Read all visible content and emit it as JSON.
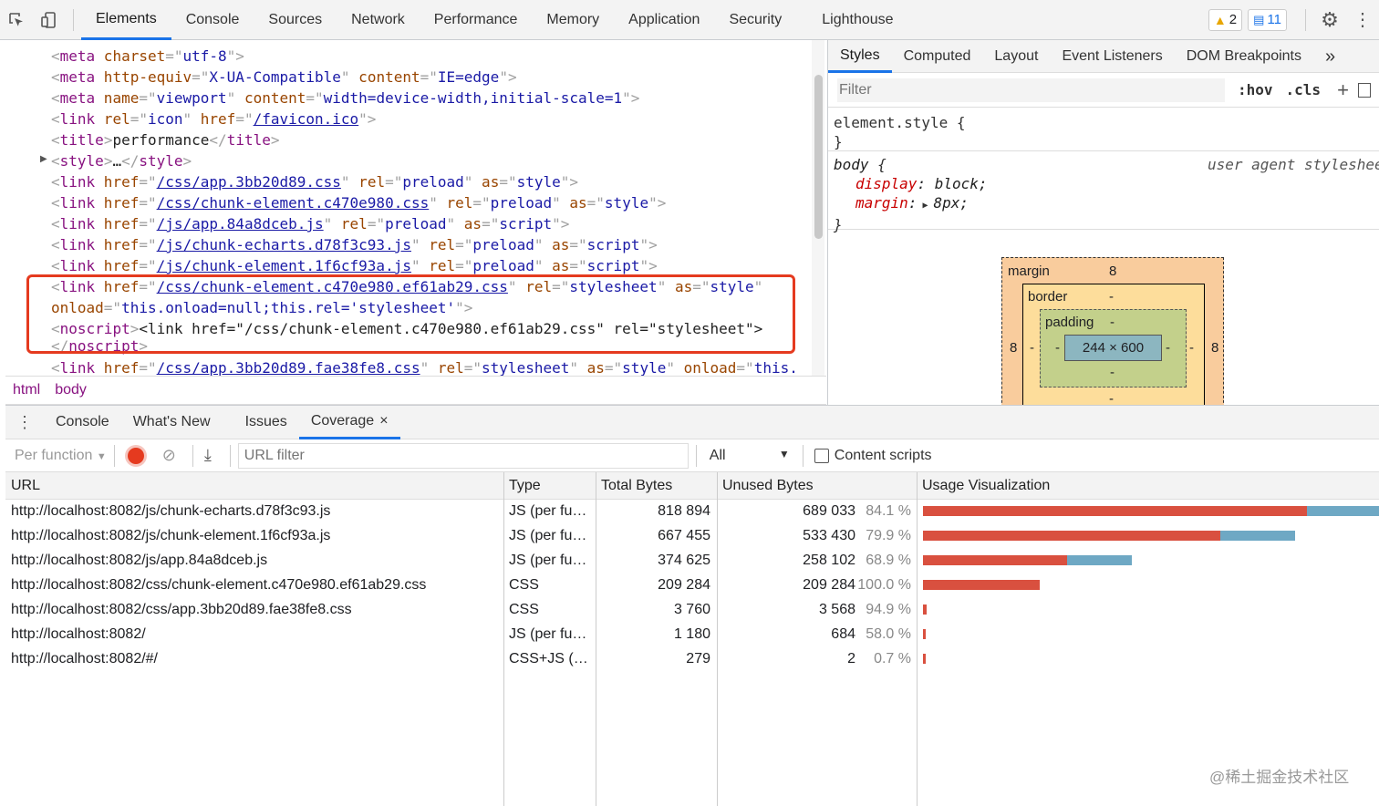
{
  "toolbar": {
    "tabs": [
      "Elements",
      "Console",
      "Sources",
      "Network",
      "Performance",
      "Memory",
      "Application",
      "Security",
      "Lighthouse"
    ],
    "active_tab": "Elements",
    "warnings": "2",
    "messages": "11"
  },
  "elements": {
    "lines": [
      {
        "parts": [
          [
            "punct",
            "<"
          ],
          [
            "tag",
            "meta"
          ],
          [
            "attr",
            " charset"
          ],
          [
            "punct",
            "=\""
          ],
          [
            "val",
            "utf-8"
          ],
          [
            "punct",
            "\">"
          ]
        ]
      },
      {
        "parts": [
          [
            "punct",
            "<"
          ],
          [
            "tag",
            "meta"
          ],
          [
            "attr",
            " http-equiv"
          ],
          [
            "punct",
            "=\""
          ],
          [
            "val",
            "X-UA-Compatible"
          ],
          [
            "punct",
            "\""
          ],
          [
            "attr",
            " content"
          ],
          [
            "punct",
            "=\""
          ],
          [
            "val",
            "IE=edge"
          ],
          [
            "punct",
            "\">"
          ]
        ]
      },
      {
        "parts": [
          [
            "punct",
            "<"
          ],
          [
            "tag",
            "meta"
          ],
          [
            "attr",
            " name"
          ],
          [
            "punct",
            "=\""
          ],
          [
            "val",
            "viewport"
          ],
          [
            "punct",
            "\""
          ],
          [
            "attr",
            " content"
          ],
          [
            "punct",
            "=\""
          ],
          [
            "val",
            "width=device-width,initial-scale=1"
          ],
          [
            "punct",
            "\">"
          ]
        ]
      },
      {
        "parts": [
          [
            "punct",
            "<"
          ],
          [
            "tag",
            "link"
          ],
          [
            "attr",
            " rel"
          ],
          [
            "punct",
            "=\""
          ],
          [
            "val",
            "icon"
          ],
          [
            "punct",
            "\""
          ],
          [
            "attr",
            " href"
          ],
          [
            "punct",
            "=\""
          ],
          [
            "link",
            "/favicon.ico"
          ],
          [
            "punct",
            "\">"
          ]
        ]
      },
      {
        "parts": [
          [
            "punct",
            "<"
          ],
          [
            "tag",
            "title"
          ],
          [
            "punct",
            ">"
          ],
          [
            "plain",
            "performance"
          ],
          [
            "punct",
            "</"
          ],
          [
            "tag",
            "title"
          ],
          [
            "punct",
            ">"
          ]
        ]
      },
      {
        "parts": [
          [
            "punct",
            "<"
          ],
          [
            "tag",
            "style"
          ],
          [
            "punct",
            ">"
          ],
          [
            "plain",
            "…"
          ],
          [
            "punct",
            "</"
          ],
          [
            "tag",
            "style"
          ],
          [
            "punct",
            ">"
          ]
        ]
      },
      {
        "parts": [
          [
            "punct",
            "<"
          ],
          [
            "tag",
            "link"
          ],
          [
            "attr",
            " href"
          ],
          [
            "punct",
            "=\""
          ],
          [
            "link",
            "/css/app.3bb20d89.css"
          ],
          [
            "punct",
            "\""
          ],
          [
            "attr",
            " rel"
          ],
          [
            "punct",
            "=\""
          ],
          [
            "val",
            "preload"
          ],
          [
            "punct",
            "\""
          ],
          [
            "attr",
            " as"
          ],
          [
            "punct",
            "=\""
          ],
          [
            "val",
            "style"
          ],
          [
            "punct",
            "\">"
          ]
        ]
      },
      {
        "parts": [
          [
            "punct",
            "<"
          ],
          [
            "tag",
            "link"
          ],
          [
            "attr",
            " href"
          ],
          [
            "punct",
            "=\""
          ],
          [
            "link",
            "/css/chunk-element.c470e980.css"
          ],
          [
            "punct",
            "\""
          ],
          [
            "attr",
            " rel"
          ],
          [
            "punct",
            "=\""
          ],
          [
            "val",
            "preload"
          ],
          [
            "punct",
            "\""
          ],
          [
            "attr",
            " as"
          ],
          [
            "punct",
            "=\""
          ],
          [
            "val",
            "style"
          ],
          [
            "punct",
            "\">"
          ]
        ]
      },
      {
        "parts": [
          [
            "punct",
            "<"
          ],
          [
            "tag",
            "link"
          ],
          [
            "attr",
            " href"
          ],
          [
            "punct",
            "=\""
          ],
          [
            "link",
            "/js/app.84a8dceb.js"
          ],
          [
            "punct",
            "\""
          ],
          [
            "attr",
            " rel"
          ],
          [
            "punct",
            "=\""
          ],
          [
            "val",
            "preload"
          ],
          [
            "punct",
            "\""
          ],
          [
            "attr",
            " as"
          ],
          [
            "punct",
            "=\""
          ],
          [
            "val",
            "script"
          ],
          [
            "punct",
            "\">"
          ]
        ]
      },
      {
        "parts": [
          [
            "punct",
            "<"
          ],
          [
            "tag",
            "link"
          ],
          [
            "attr",
            " href"
          ],
          [
            "punct",
            "=\""
          ],
          [
            "link",
            "/js/chunk-echarts.d78f3c93.js"
          ],
          [
            "punct",
            "\""
          ],
          [
            "attr",
            " rel"
          ],
          [
            "punct",
            "=\""
          ],
          [
            "val",
            "preload"
          ],
          [
            "punct",
            "\""
          ],
          [
            "attr",
            " as"
          ],
          [
            "punct",
            "=\""
          ],
          [
            "val",
            "script"
          ],
          [
            "punct",
            "\">"
          ]
        ]
      },
      {
        "parts": [
          [
            "punct",
            "<"
          ],
          [
            "tag",
            "link"
          ],
          [
            "attr",
            " href"
          ],
          [
            "punct",
            "=\""
          ],
          [
            "link",
            "/js/chunk-element.1f6cf93a.js"
          ],
          [
            "punct",
            "\""
          ],
          [
            "attr",
            " rel"
          ],
          [
            "punct",
            "=\""
          ],
          [
            "val",
            "preload"
          ],
          [
            "punct",
            "\""
          ],
          [
            "attr",
            " as"
          ],
          [
            "punct",
            "=\""
          ],
          [
            "val",
            "script"
          ],
          [
            "punct",
            "\">"
          ]
        ]
      },
      {
        "parts": [
          [
            "punct",
            "<"
          ],
          [
            "tag",
            "link"
          ],
          [
            "attr",
            " href"
          ],
          [
            "punct",
            "=\""
          ],
          [
            "link",
            "/css/chunk-element.c470e980.ef61ab29.css"
          ],
          [
            "punct",
            "\""
          ],
          [
            "attr",
            " rel"
          ],
          [
            "punct",
            "=\""
          ],
          [
            "val",
            "stylesheet"
          ],
          [
            "punct",
            "\""
          ],
          [
            "attr",
            " as"
          ],
          [
            "punct",
            "=\""
          ],
          [
            "val",
            "style"
          ],
          [
            "punct",
            "\""
          ]
        ]
      },
      {
        "parts": [
          [
            "attr",
            "onload"
          ],
          [
            "punct",
            "=\""
          ],
          [
            "val",
            "this.onload=null;this.rel='stylesheet'"
          ],
          [
            "punct",
            "\">"
          ]
        ]
      },
      {
        "parts": [
          [
            "punct",
            "<"
          ],
          [
            "tag",
            "noscript"
          ],
          [
            "punct",
            ">"
          ],
          [
            "plain",
            "<link href=\"/css/chunk-element.c470e980.ef61ab29.css\" rel=\"stylesheet\">"
          ]
        ]
      },
      {
        "parts": [
          [
            "punct",
            "</"
          ],
          [
            "tag",
            "noscript"
          ],
          [
            "punct",
            ">"
          ]
        ]
      },
      {
        "parts": [
          [
            "punct",
            "<"
          ],
          [
            "tag",
            "link"
          ],
          [
            "attr",
            " href"
          ],
          [
            "punct",
            "=\""
          ],
          [
            "link",
            "/css/app.3bb20d89.fae38fe8.css"
          ],
          [
            "punct",
            "\""
          ],
          [
            "attr",
            " rel"
          ],
          [
            "punct",
            "=\""
          ],
          [
            "val",
            "stylesheet"
          ],
          [
            "punct",
            "\""
          ],
          [
            "attr",
            " as"
          ],
          [
            "punct",
            "=\""
          ],
          [
            "val",
            "style"
          ],
          [
            "punct",
            "\""
          ],
          [
            "attr",
            " onload"
          ],
          [
            "punct",
            "=\""
          ],
          [
            "val",
            "this."
          ]
        ]
      }
    ],
    "crumbs": [
      "html",
      "body"
    ]
  },
  "styles": {
    "tabs": [
      "Styles",
      "Computed",
      "Layout",
      "Event Listeners",
      "DOM Breakpoints"
    ],
    "active_tab": "Styles",
    "more": "»",
    "filter_placeholder": "Filter",
    "hov": ":hov",
    "cls": ".cls",
    "add": "+",
    "element_style_open": "element.style {",
    "close": "}",
    "body_selector": "body",
    "body_open": " {",
    "ua_label": "user agent stylesheet",
    "prop1_name": "display",
    "prop1_value": "block;",
    "prop2_name": "margin",
    "prop2_value": "8px;",
    "boxmodel": {
      "margin_label": "margin",
      "margin_top": "8",
      "margin_left": "8",
      "margin_right": "8",
      "border_label": "border",
      "border_top": "-",
      "border_left": "-",
      "border_right": "-",
      "border_bottom": "-",
      "padding_label": "padding",
      "padding_top": "-",
      "padding_left": "-",
      "padding_right": "-",
      "padding_bottom": "-",
      "content": "244 × 600"
    }
  },
  "drawer": {
    "tabs": [
      "Console",
      "What's New",
      "Issues",
      "Coverage"
    ],
    "active_tab": "Coverage",
    "close": "×"
  },
  "coverage": {
    "per_function": "Per function",
    "url_filter_placeholder": "URL filter",
    "type_select": "All",
    "content_scripts": "Content scripts",
    "headers": [
      "URL",
      "Type",
      "Total Bytes",
      "Unused Bytes",
      "Usage Visualization"
    ],
    "rows": [
      {
        "url": "http://localhost:8082/js/chunk-echarts.d78f3c93.js",
        "type": "JS (per fu…",
        "total": "818 894",
        "unused": "689 033",
        "pct": "84.1 %",
        "total_num": 818894,
        "unused_num": 689033
      },
      {
        "url": "http://localhost:8082/js/chunk-element.1f6cf93a.js",
        "type": "JS (per fu…",
        "total": "667 455",
        "unused": "533 430",
        "pct": "79.9 %",
        "total_num": 667455,
        "unused_num": 533430
      },
      {
        "url": "http://localhost:8082/js/app.84a8dceb.js",
        "type": "JS (per fu…",
        "total": "374 625",
        "unused": "258 102",
        "pct": "68.9 %",
        "total_num": 374625,
        "unused_num": 258102
      },
      {
        "url": "http://localhost:8082/css/chunk-element.c470e980.ef61ab29.css",
        "type": "CSS",
        "total": "209 284",
        "unused": "209 284",
        "pct": "100.0 %",
        "total_num": 209284,
        "unused_num": 209284
      },
      {
        "url": "http://localhost:8082/css/app.3bb20d89.fae38fe8.css",
        "type": "CSS",
        "total": "3 760",
        "unused": "3 568",
        "pct": "94.9 %",
        "total_num": 3760,
        "unused_num": 3568
      },
      {
        "url": "http://localhost:8082/",
        "type": "JS (per fu…",
        "total": "1 180",
        "unused": "684",
        "pct": "58.0 %",
        "total_num": 1180,
        "unused_num": 684
      },
      {
        "url": "http://localhost:8082/#/",
        "type": "CSS+JS (…",
        "total": "279",
        "unused": "2",
        "pct": "0.7 %",
        "total_num": 279,
        "unused_num": 2
      }
    ],
    "colors": {
      "unused": "#d9503f",
      "used": "#6ea8c4"
    }
  },
  "watermark": "@稀土掘金技术社区"
}
